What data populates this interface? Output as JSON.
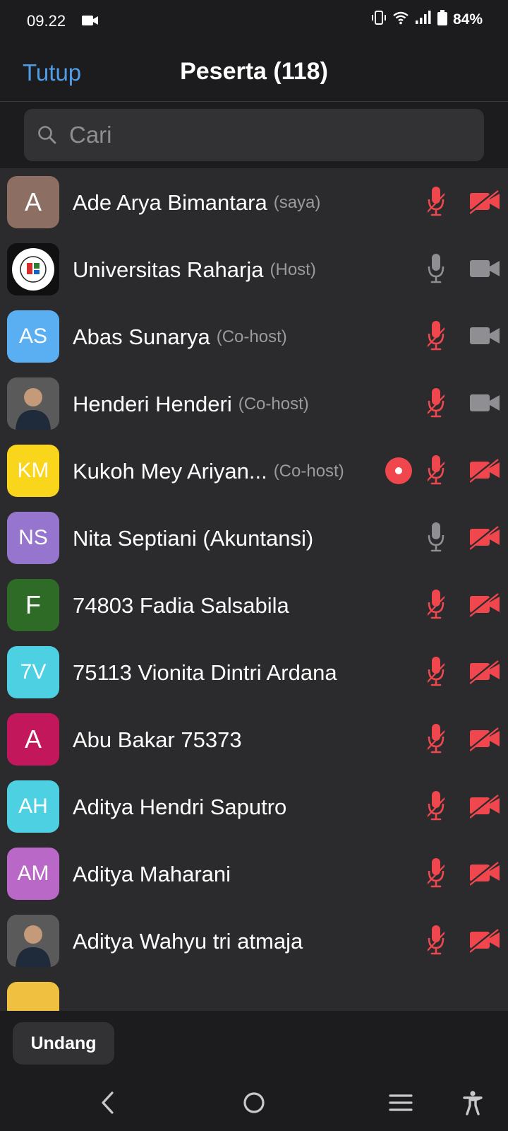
{
  "status_bar": {
    "time": "09.22",
    "battery": "84%"
  },
  "header": {
    "close_label": "Tutup",
    "title": "Peserta (118)"
  },
  "search": {
    "placeholder": "Cari"
  },
  "participants": [
    {
      "initials": "A",
      "avatar_color": "#8d6e63",
      "name": "Ade Arya Bimantara",
      "role": "(saya)",
      "mic": "muted",
      "video": "off"
    },
    {
      "initials": "",
      "avatar_color": "#101010",
      "avatar_image": "universitas-logo",
      "name": "Universitas Raharja",
      "role": "(Host)",
      "mic": "on",
      "video": "on"
    },
    {
      "initials": "AS",
      "avatar_color": "#5aaef2",
      "name": "Abas Sunarya",
      "role": "(Co-host)",
      "mic": "muted",
      "video": "on"
    },
    {
      "initials": "",
      "avatar_color": "#4a4a4a",
      "avatar_image": "person-photo",
      "name": "Henderi Henderi",
      "role": "(Co-host)",
      "mic": "muted",
      "video": "on"
    },
    {
      "initials": "KM",
      "avatar_color": "#f9d51c",
      "name": "Kukoh Mey Ariyan...",
      "role": "(Co-host)",
      "mic": "muted",
      "video": "off",
      "recording": true
    },
    {
      "initials": "NS",
      "avatar_color": "#9575cd",
      "name": "Nita Septiani (Akuntansi)",
      "role": "",
      "mic": "on",
      "video": "off"
    },
    {
      "initials": "F",
      "avatar_color": "#2e6b27",
      "name": "74803 Fadia Salsabila",
      "role": "",
      "mic": "muted",
      "video": "off"
    },
    {
      "initials": "7V",
      "avatar_color": "#4dd0e1",
      "name": "75113 Vionita Dintri Ardana",
      "role": "",
      "mic": "muted",
      "video": "off"
    },
    {
      "initials": "A",
      "avatar_color": "#c2185b",
      "name": "Abu Bakar 75373",
      "role": "",
      "mic": "muted",
      "video": "off"
    },
    {
      "initials": "AH",
      "avatar_color": "#4dd0e1",
      "name": "Aditya Hendri Saputro",
      "role": "",
      "mic": "muted",
      "video": "off"
    },
    {
      "initials": "AM",
      "avatar_color": "#ba68c8",
      "name": "Aditya Maharani",
      "role": "",
      "mic": "muted",
      "video": "off"
    },
    {
      "initials": "",
      "avatar_color": "#e53935",
      "avatar_image": "person-photo",
      "name": "Aditya Wahyu tri atmaja",
      "role": "",
      "mic": "muted",
      "video": "off"
    }
  ],
  "bottom": {
    "invite_label": "Undang"
  },
  "colors": {
    "accent": "#4f9de8",
    "muted_red": "#f0474e",
    "icon_gray": "#8e8e93"
  }
}
